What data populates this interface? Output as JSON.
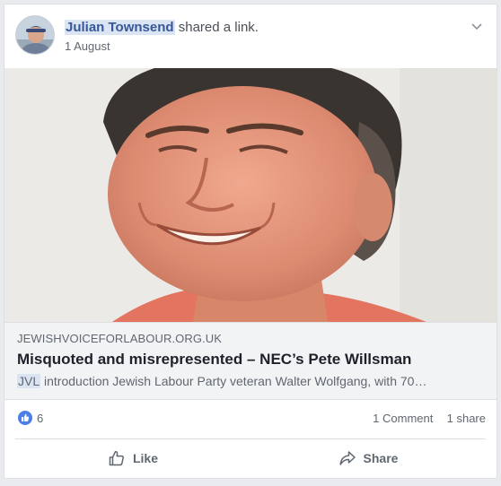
{
  "post": {
    "author": "Julian Townsend",
    "action": " shared a link.",
    "date": "1 August",
    "options_icon": "chevron-down-icon"
  },
  "link": {
    "domain": "JEWISHVOICEFORLABOUR.ORG.UK",
    "title": "Misquoted and misrepresented – NEC’s Pete Willsman",
    "description_highlight": "JVL",
    "description": " introduction Jewish Labour Party veteran Walter Wolfgang, with 70…"
  },
  "reactions": {
    "like_icon": "thumbs-up-icon",
    "like_color": "#4b7ee8",
    "count": "6",
    "comments": "1 Comment",
    "shares": "1 share"
  },
  "actions": {
    "like": "Like",
    "share": "Share"
  },
  "colors": {
    "link_blue": "#365899",
    "caption_bg": "#f2f3f5",
    "muted_text": "#606770"
  }
}
